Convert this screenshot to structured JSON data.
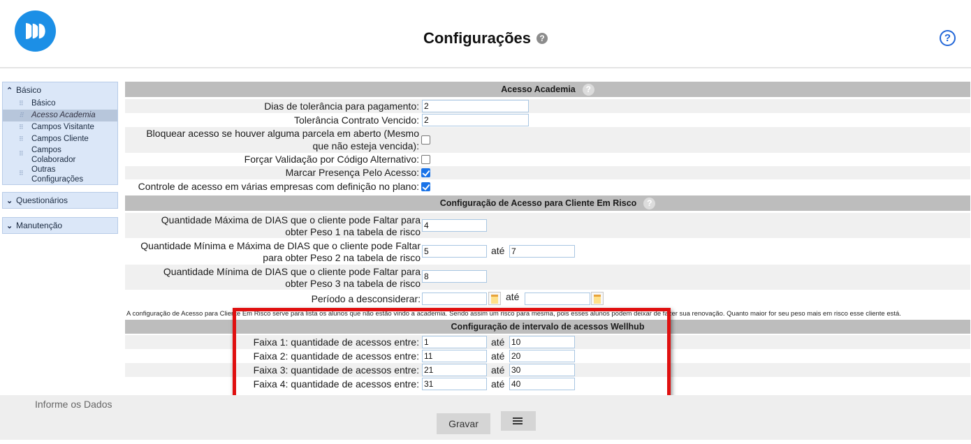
{
  "header": {
    "title": "Configurações"
  },
  "sidebar": {
    "basico": {
      "label": "Básico",
      "items": [
        {
          "label": "Básico"
        },
        {
          "label": "Acesso Academia"
        },
        {
          "label": "Campos Visitante"
        },
        {
          "label": "Campos Cliente"
        },
        {
          "label": "Campos Colaborador"
        },
        {
          "label": "Outras Configurações"
        }
      ]
    },
    "questionarios": {
      "label": "Questionários"
    },
    "manutencao": {
      "label": "Manutenção"
    }
  },
  "acesso_academia": {
    "title": "Acesso Academia",
    "dias_tolerancia": {
      "label": "Dias de tolerância para pagamento:",
      "value": "2"
    },
    "tolerancia_contrato": {
      "label": "Tolerância Contrato Vencido:",
      "value": "2"
    },
    "bloquear_acesso": {
      "label_line1": "Bloquear acesso se houver alguma parcela em aberto (Mesmo",
      "label_line2": "que não esteja vencida):",
      "checked": false
    },
    "forcar_validacao": {
      "label": "Forçar Validação por Código Alternativo:",
      "checked": false
    },
    "marcar_presenca": {
      "label": "Marcar Presença Pelo Acesso:",
      "checked": true
    },
    "controle_acesso": {
      "label": "Controle de acesso em várias empresas com definição no plano:",
      "checked": true
    }
  },
  "cliente_risco": {
    "title": "Configuração de Acesso para Cliente Em Risco",
    "peso1": {
      "label_line1": "Quantidade Máxima de DIAS que o cliente pode Faltar para",
      "label_line2": "obter Peso 1 na tabela de risco",
      "value": "4"
    },
    "peso2": {
      "label_line1": "Quantidade Mínima e Máxima de DIAS que o cliente pode Faltar",
      "label_line2": "para obter Peso 2 na tabela de risco",
      "value_min": "5",
      "value_max": "7"
    },
    "peso3": {
      "label_line1": "Quantidade Mínima de DIAS que o cliente pode Faltar para",
      "label_line2": "obter Peso 3 na tabela de risco",
      "value": "8"
    },
    "periodo": {
      "label": "Período a desconsiderar:",
      "from": "",
      "to": ""
    },
    "ate": "até",
    "note": "A configuração de Acesso para Cliente Em Risco serve para lista os alunos que não estão vindo a academia. Sendo assim um risco para mesma, pois esses alunos podem deixar de fazer sua renovação. Quanto maior for seu peso mais em risco esse cliente está."
  },
  "wellhub": {
    "title": "Configuração de intervalo de acessos Wellhub",
    "faixas": [
      {
        "label": "Faixa 1: quantidade de acessos entre:",
        "from": "1",
        "to": "10"
      },
      {
        "label": "Faixa 2: quantidade de acessos entre:",
        "from": "11",
        "to": "20"
      },
      {
        "label": "Faixa 3: quantidade de acessos entre:",
        "from": "21",
        "to": "30"
      },
      {
        "label": "Faixa 4: quantidade de acessos entre:",
        "from": "31",
        "to": "40"
      }
    ]
  },
  "footer": {
    "info_label": "Informe os Dados",
    "save_label": "Gravar"
  }
}
